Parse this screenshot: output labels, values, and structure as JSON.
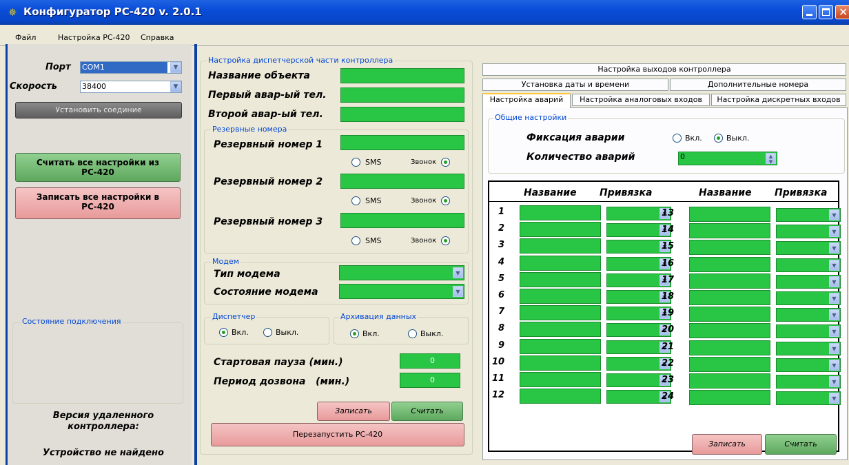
{
  "window": {
    "title": "Конфигуратор РС-420 v. 2.0.1"
  },
  "menu": [
    "Файл",
    "Настройка РС-420",
    "Справка"
  ],
  "left": {
    "port_label": "Порт",
    "port_value": "COM1",
    "speed_label": "Скорость",
    "speed_value": "38400",
    "connect_button": "Установить соединие",
    "read_all_button": "Считать все настройки из РС-420",
    "write_all_button": "Записать все настройки в РС-420",
    "status_group": "Состояние подключения",
    "version_label": "Версия удаленного контроллера:",
    "device_status": "Устройство не найдено"
  },
  "middle": {
    "group_title": "Настройка диспетчерской части контроллера",
    "object_name": "Название объекта",
    "phone1": "Первый авар-ый тел.",
    "phone2": "Второй авар-ый тел.",
    "reserve_group": "Резервные номера",
    "reserve1": "Резервный номер 1",
    "reserve2": "Резервный номер 2",
    "reserve3": "Резервный номер 3",
    "sms": "SMS",
    "call": "Звонок",
    "modem_group": "Модем",
    "modem_type": "Тип модема",
    "modem_state": "Состояние модема",
    "dispatcher_group": "Диспетчер",
    "archive_group": "Архивация данных",
    "on": "Вкл.",
    "off": "Выкл.",
    "start_pause": "Стартовая пауза (мин.)",
    "start_pause_value": "0",
    "dial_period": "Период дозвона   (мин.)",
    "dial_period_value": "0",
    "write_button": "Записать",
    "read_button": "Считать",
    "restart_button": "Перезапустить РС-420"
  },
  "right": {
    "tabs_row1": [
      "Настройка выходов контроллера"
    ],
    "tabs_row2": [
      "Установка даты и времени",
      "Дополнительные номера"
    ],
    "tabs_row3": [
      "Настройка аварий",
      "Настройка аналоговых входов",
      "Настройка дискретных входов"
    ],
    "general_group": "Общие настройки",
    "fix_label": "Фиксация аварии",
    "fix_on": "Вкл.",
    "fix_off": "Выкл.",
    "count_label": "Количество аварий",
    "count_value": "0",
    "col_name": "Название",
    "col_binding": "Привязка",
    "rows_left": [
      "1",
      "2",
      "3",
      "4",
      "5",
      "6",
      "7",
      "8",
      "9",
      "10",
      "11",
      "12"
    ],
    "rows_right": [
      "13",
      "14",
      "15",
      "16",
      "17",
      "18",
      "19",
      "20",
      "21",
      "22",
      "23",
      "24"
    ],
    "write_button": "Записать",
    "read_button": "Считать"
  },
  "colors": {
    "field_green": "#29C545",
    "title_blue": "#0A4DD8",
    "group_label": "#0046D5"
  }
}
